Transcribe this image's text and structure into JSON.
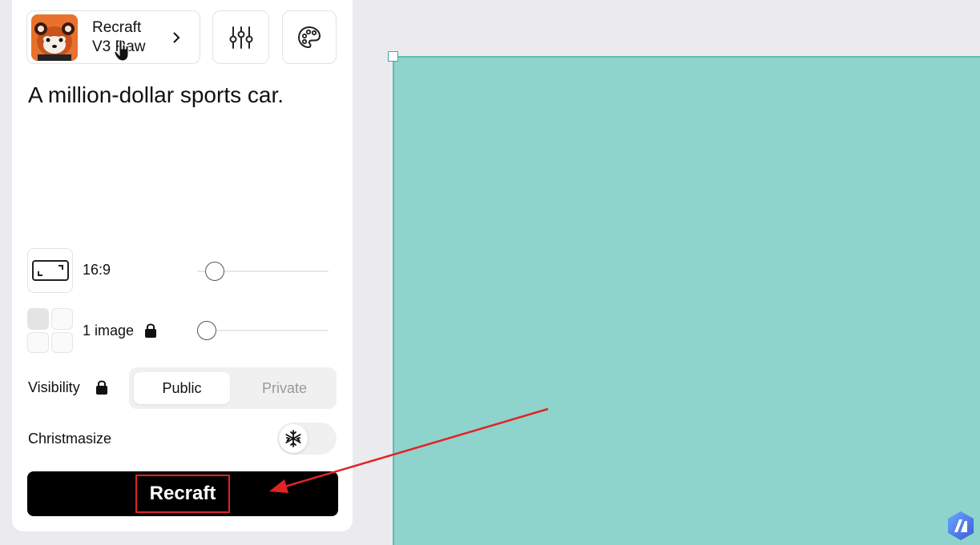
{
  "model": {
    "name_line1": "Recraft",
    "name_line2": "V3 Raw",
    "avatar_icon": "red-panda-avatar"
  },
  "toolbar": {
    "settings_icon": "sliders-icon",
    "style_icon": "palette-icon"
  },
  "prompt": {
    "text": "A million-dollar sports car."
  },
  "aspect_ratio": {
    "label": "16:9",
    "icon": "aspect-ratio-icon"
  },
  "image_count": {
    "label": "1 image",
    "icon": "lock-icon"
  },
  "visibility": {
    "label": "Visibility",
    "options": [
      "Public",
      "Private"
    ],
    "selected": "Public"
  },
  "christmasize": {
    "label": "Christmasize",
    "icon": "snowflake-icon",
    "enabled": false
  },
  "action": {
    "label": "Recraft"
  },
  "colors": {
    "canvas": "#8fd3cd",
    "accent_red": "#e02424",
    "button_bg": "#000000"
  }
}
